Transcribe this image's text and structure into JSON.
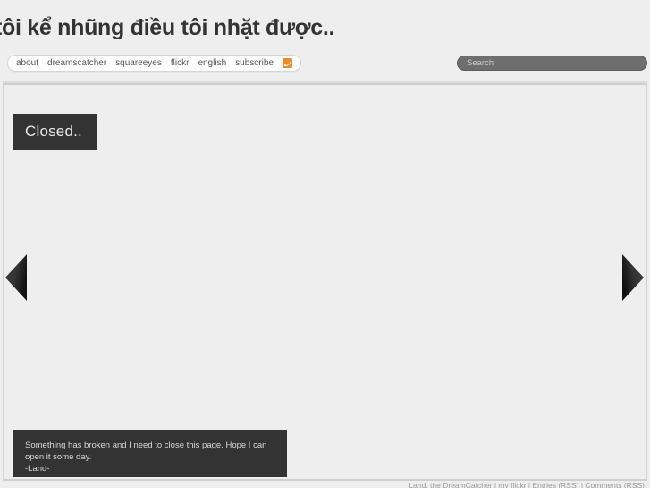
{
  "header": {
    "site_title": "tôi kể nhũng điều tôi nhặt được.."
  },
  "nav": {
    "items": [
      {
        "label": "about"
      },
      {
        "label": "dreamscatcher"
      },
      {
        "label": "squareeyes"
      },
      {
        "label": "flickr"
      },
      {
        "label": "english"
      },
      {
        "label": "subscribe"
      }
    ],
    "rss_icon": "rss-icon"
  },
  "search": {
    "placeholder": "Search",
    "value": ""
  },
  "main": {
    "closed_label": "Closed..",
    "note": "Something has broken and I need to close this page. Hope I can open it some day.\n-Land-",
    "prev_arrow_icon": "triangle-left-icon",
    "next_arrow_icon": "triangle-right-icon"
  },
  "footer": {
    "text": "Land, the DreamCatcher | my flickr | Entries (RSS) | Comments (RSS)"
  },
  "colors": {
    "page_background": "#eeeeee",
    "panel_dark": "#333333",
    "text_dark": "#333333",
    "rss_orange": "#f08a24",
    "search_background": "#6e6e6e",
    "border": "#d3d3d3"
  }
}
